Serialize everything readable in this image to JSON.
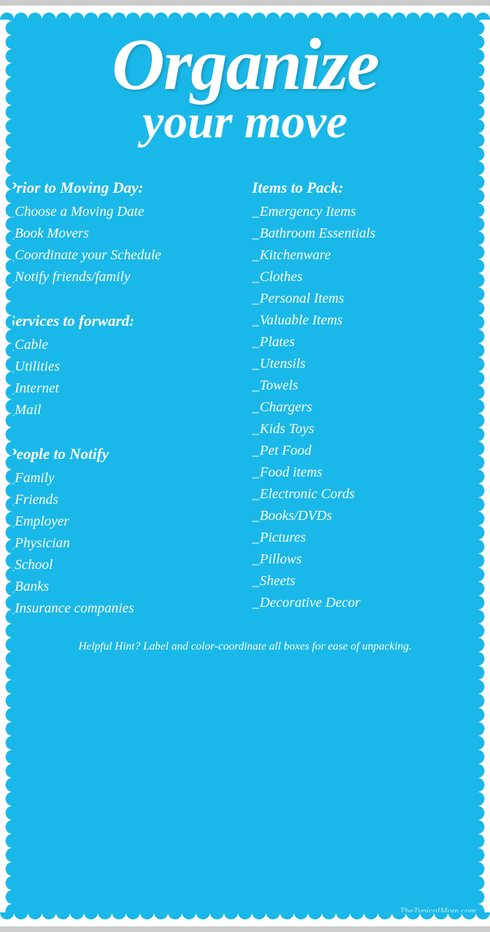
{
  "title": {
    "line1": "Organize",
    "line2": "your move"
  },
  "left": {
    "section1": {
      "heading": "Prior to Moving Day:",
      "items": [
        "Choose a Moving Date",
        "Book Movers",
        "Coordinate your Schedule",
        "Notify friends/family"
      ]
    },
    "section2": {
      "heading": "Services to forward:",
      "items": [
        "Cable",
        "Utilities",
        "Internet",
        "Mail"
      ]
    },
    "section3": {
      "heading": "People to Notify",
      "items": [
        "Family",
        "Friends",
        "Employer",
        "Physician",
        "School",
        "Banks",
        "Insurance companies"
      ]
    }
  },
  "right": {
    "section1": {
      "heading": "Items to Pack:",
      "items": [
        "Emergency Items",
        "Bathroom Essentials",
        "Kitchenware",
        "Clothes",
        "Personal  Items",
        "Valuable  Items",
        "Plates",
        "Utensils",
        "Towels",
        "Chargers",
        "Kids  Toys",
        "Pet Food",
        "Food items",
        "Electronic Cords",
        "Books/DVDs",
        "Pictures",
        "Pillows",
        "Sheets",
        "Decorative  Decor"
      ]
    }
  },
  "hint": "Helpful Hint?  Label and color-coordinate all boxes for ease of unpacking.",
  "watermark": "TheTypicalMom.com"
}
